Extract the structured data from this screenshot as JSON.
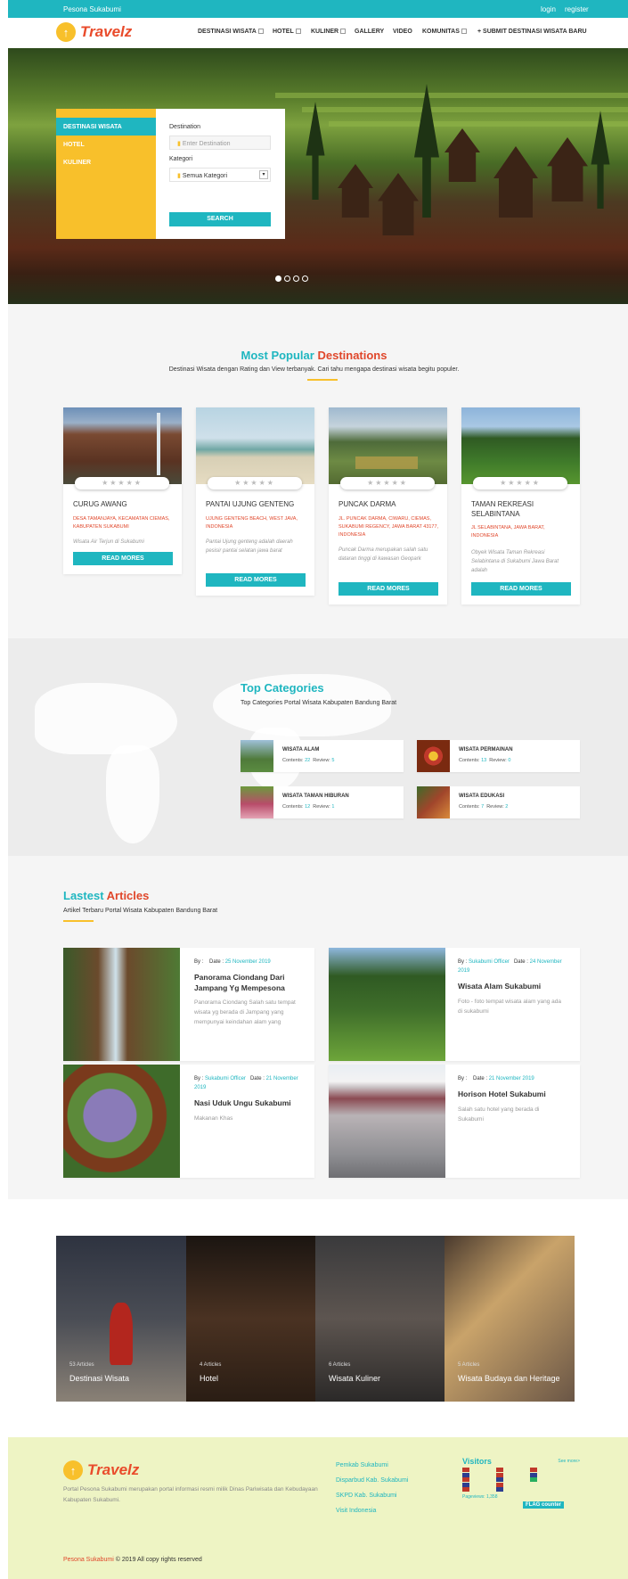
{
  "topbar": {
    "site_name": "Pesona Sukabumi",
    "login": "login",
    "register": "register"
  },
  "brand": {
    "logo_text": "Travelz"
  },
  "nav": [
    {
      "label": "DESTINASI WISATA"
    },
    {
      "label": "HOTEL"
    },
    {
      "label": "KULINER"
    },
    {
      "label": "GALLERY"
    },
    {
      "label": "VIDEO"
    },
    {
      "label": "KOMUNITAS"
    },
    {
      "label": "+ SUBMIT DESTINASI WISATA BARU"
    }
  ],
  "search": {
    "tabs": [
      "DESTINASI WISATA",
      "HOTEL",
      "KULINER"
    ],
    "destination_label": "Destination",
    "destination_placeholder": "Enter Destination",
    "category_label": "Kategori",
    "category_value": "Semua Kategori",
    "button": "SEARCH"
  },
  "popular": {
    "title_a": "Most Popular",
    "title_b": "Destinations",
    "subtitle": "Destinasi Wisata dengan Rating dan View terbanyak. Cari tahu mengapa destinasi wisata begitu populer.",
    "stars": "★★★★★",
    "cards": [
      {
        "title": "CURUG AWANG",
        "address": "DESA TAMANJAYA, KECAMATAN CIEMAS, KABUPATEN SUKABUMI",
        "desc": "Wisata Air Terjun di Sukabumi",
        "button": "READ MORES"
      },
      {
        "title": "PANTAI UJUNG GENTENG",
        "address": "UJUNG GENTENG BEACH, WEST JAVA, INDONESIA",
        "desc": "Pantai Ujung genteng adalah daerah pesisir pantai selatan jawa barat",
        "button": "READ MORES"
      },
      {
        "title": "PUNCAK DARMA",
        "address": "JL. PUNCAK DARMA, CIWARU, CIEMAS, SUKABUMI REGENCY, JAWA BARAT 43177, INDONESIA",
        "desc": "Puncak Darma merupakan salah satu dataran tinggi di kawasan Geopark",
        "button": "READ MORES"
      },
      {
        "title": "TAMAN REKREASI SELABINTANA",
        "address": "JL SELABINTANA, JAWA BARAT, INDONESIA",
        "desc": "Obyek Wisata Taman Rekreasi Selabintana di Sukabumi Jawa Barat adalah",
        "button": "READ MORES"
      }
    ]
  },
  "categories": {
    "title": "Top Categories",
    "subtitle": "Top Categories Portal Wisata Kabupaten Bandung Barat",
    "contents_label": "Contents:",
    "review_label": "Review:",
    "items": [
      {
        "name": "WISATA ALAM",
        "contents": "22",
        "review": "5"
      },
      {
        "name": "WISATA PERMAINAN",
        "contents": "13",
        "review": "0"
      },
      {
        "name": "WISATA TAMAN HIBURAN",
        "contents": "12",
        "review": "1"
      },
      {
        "name": "WISATA EDUKASI",
        "contents": "7",
        "review": "2"
      }
    ]
  },
  "articles": {
    "title_a": "Lastest",
    "title_b": "Articles",
    "subtitle": "Artikel Terbaru Portal Wisata Kabupaten Bandung Barat",
    "by_label": "By :",
    "date_label": "Date :",
    "items": [
      {
        "author": "",
        "date": "25 November 2019",
        "title": "Panorama Ciondang Dari Jampang Yg Mempesona",
        "desc": "Panorama Ciondang Salah satu tempat wisata yg berada di Jampang yang mempunyai keindahan alam yang"
      },
      {
        "author": "Sukabumi Officer",
        "date": "24 November 2019",
        "title": "Wisata Alam Sukabumi",
        "desc": "Foto - foto tempat wisata alam yang ada di sukabumi"
      },
      {
        "author": "Sukabumi Officer",
        "date": "21 November 2019",
        "title": "Nasi Uduk Ungu Sukabumi",
        "desc": "Makanan Khas"
      },
      {
        "author": "",
        "date": "21 November 2019",
        "title": "Horison Hotel Sukabumi",
        "desc": "Salah satu hotel yang berada di Sukabumi"
      }
    ]
  },
  "explore": [
    {
      "count": "53 Articles",
      "name": "Destinasi Wisata"
    },
    {
      "count": "4 Articles",
      "name": "Hotel"
    },
    {
      "count": "6 Articles",
      "name": "Wisata Kuliner"
    },
    {
      "count": "5 Articles",
      "name": "Wisata Budaya dan Heritage"
    }
  ],
  "footer": {
    "description": "Portal Pesona Sukabumi merupakan portal informasi resmi milik Dinas Pariwisata dan Kebudayaan Kabupaten Sukabumi.",
    "links": [
      "Pemkab Sukabumi",
      "Disparbud Kab. Sukabumi",
      "SKPD Kab. Sukabumi",
      "Visit Indonesia"
    ],
    "visitors_title": "Visitors",
    "see_more": "See more>",
    "pageviews": "Pageviews: 1,358",
    "flag_counter": "FLAG counter",
    "copyright_brand": "Pesona Sukabumi",
    "copyright_rest": "© 2019 All copy rights reserved"
  },
  "colors": {
    "accent": "#1fb6c0",
    "brand_red": "#e0472b",
    "yellow": "#f8c02b"
  }
}
